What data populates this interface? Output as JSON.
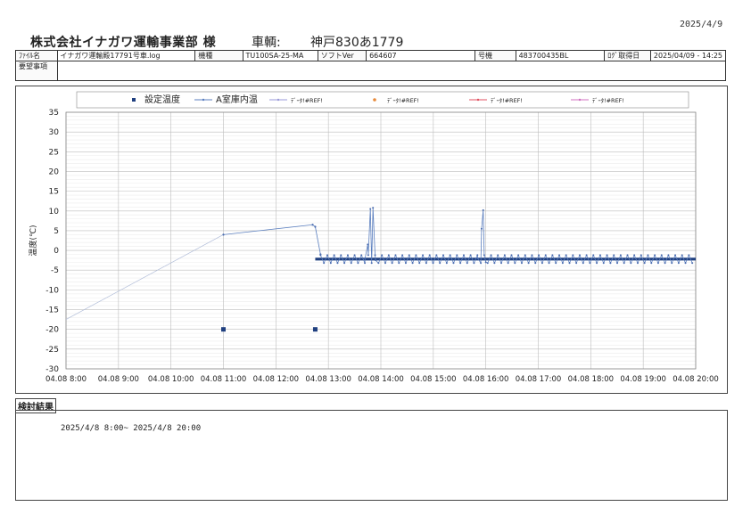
{
  "header": {
    "print_date": "2025/4/9",
    "company": "株式会社イナガワ運輸事業部 様",
    "vehicle_label": "車輌:",
    "vehicle_no": "神戸830あ1779"
  },
  "info": {
    "file_label": "ﾌｧｲﾙ名",
    "file_value": "イナガワ運輸殿17791号車.log",
    "model_label": "機種",
    "model_value": "TU100SA-25-MA",
    "soft_label": "ソフトVer",
    "soft_value": "664607",
    "unit_label": "号機",
    "unit_value": "483700435BL",
    "log_label": "ﾛｸﾞ取得日",
    "log_value": "2025/04/09 - 14:25",
    "request_label": "要望事項"
  },
  "chart_data": {
    "type": "line",
    "ylabel": "温度(℃)",
    "ylim": [
      -30,
      35
    ],
    "yticks": [
      "35",
      "30",
      "25",
      "20",
      "15",
      "10",
      "5",
      "0",
      "-5",
      "-10",
      "-15",
      "-20",
      "-25",
      "-30"
    ],
    "xticks": [
      "04.08 8:00",
      "04.08 9:00",
      "04.08 10:00",
      "04.08 11:00",
      "04.08 12:00",
      "04.08 13:00",
      "04.08 14:00",
      "04.08 15:00",
      "04.08 16:00",
      "04.08 17:00",
      "04.08 18:00",
      "04.08 19:00",
      "04.08 20:00"
    ],
    "legend": [
      {
        "label": "設定温度",
        "color": "#1f3f7f",
        "marker": "square"
      },
      {
        "label": "A室庫内温",
        "color": "#5b7fbf",
        "marker": "line"
      },
      {
        "label": "ﾃﾞｰﾀ!#REF!",
        "color": "#9a9ad8",
        "marker": "line"
      },
      {
        "label": "ﾃﾞｰﾀ!#REF!",
        "color": "#e88a3a",
        "marker": "dot"
      },
      {
        "label": "ﾃﾞｰﾀ!#REF!",
        "color": "#e05060",
        "marker": "line"
      },
      {
        "label": "ﾃﾞｰﾀ!#REF!",
        "color": "#d070c0",
        "marker": "line"
      }
    ],
    "setpoint_series": {
      "name": "設定温度",
      "points": [
        [
          11.0,
          -20
        ],
        [
          12.75,
          -20
        ],
        [
          12.75,
          -2.2
        ],
        [
          20.0,
          -2.2
        ]
      ]
    },
    "temp_series": {
      "name": "A室庫内温",
      "points": [
        [
          7.95,
          -17.5
        ],
        [
          11.0,
          4.0
        ],
        [
          12.7,
          6.5
        ],
        [
          12.75,
          6.0
        ],
        [
          12.85,
          -1.0
        ],
        [
          13.0,
          -1.5
        ],
        [
          13.7,
          -2
        ],
        [
          13.75,
          1.5
        ],
        [
          13.8,
          10.5
        ],
        [
          13.85,
          10.8
        ],
        [
          13.9,
          -2.5
        ],
        [
          15.85,
          -2
        ],
        [
          15.92,
          5.5
        ],
        [
          15.95,
          10.2
        ],
        [
          16.0,
          -3
        ]
      ],
      "oscillation": {
        "start": 12.85,
        "end": 20.0,
        "high": -1.2,
        "low": -3.2,
        "period": 0.13
      }
    }
  },
  "result": {
    "title": "検討結果",
    "text": "2025/4/8 8:00~ 2025/4/8 20:00"
  }
}
